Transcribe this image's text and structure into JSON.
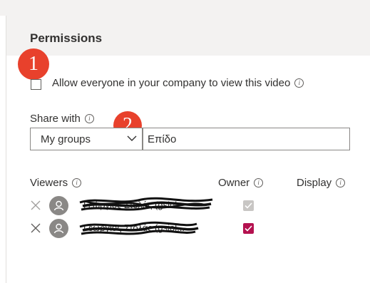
{
  "panel": {
    "title": "Permissions"
  },
  "callouts": {
    "first": "1",
    "second": "2"
  },
  "allow_everyone": {
    "label": "Allow everyone in your company to view this video",
    "checked": false
  },
  "share_with": {
    "label": "Share with",
    "groups_select_value": "My groups",
    "search_value": "Επίδο"
  },
  "viewers_table": {
    "columns": {
      "viewers": "Viewers",
      "owner": "Owner",
      "display": "Display"
    },
    "rows": [
      {
        "name": "Γεώργιος Στολάς (gsiol...",
        "owner": true,
        "owner_disabled": true
      },
      {
        "name": "Γεώργιος Στολάς (gsiol...",
        "owner": true,
        "owner_disabled": false
      }
    ]
  },
  "colors": {
    "callout": "#e8412c",
    "owner_checked": "#b4114f",
    "owner_disabled": "#c8c6c4",
    "header_background": "#f3f2f1"
  },
  "icons": {
    "info": "info-icon",
    "chevron": "chevron-down-icon",
    "remove": "close-icon",
    "avatar": "person-icon",
    "check": "checkmark-icon"
  }
}
